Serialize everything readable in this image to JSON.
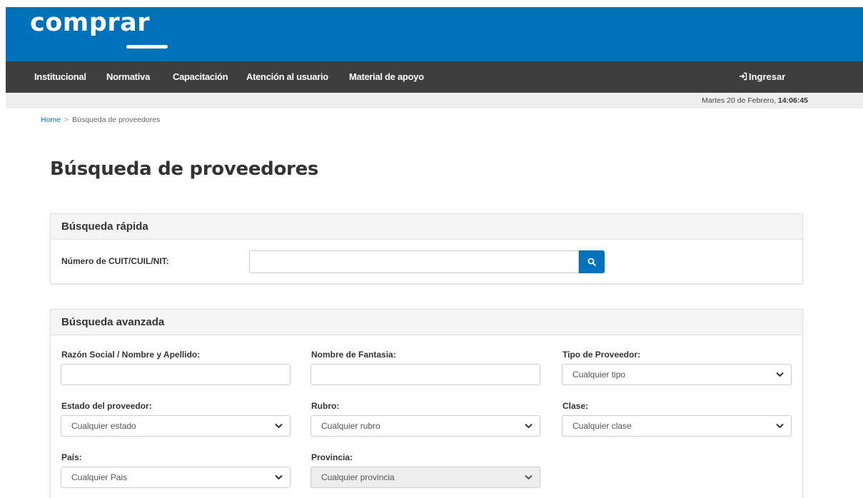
{
  "header": {
    "logo": "comprar"
  },
  "nav": {
    "items": [
      {
        "label": "Institucional"
      },
      {
        "label": "Normativa"
      },
      {
        "label": "Capacitación"
      },
      {
        "label": "Atención al usuario"
      },
      {
        "label": "Material de apoyo"
      }
    ],
    "login_label": "Ingresar",
    "login_icon": "sign-in-icon"
  },
  "datebar": {
    "date_prefix": "Martes 20 de Febrero,",
    "time": "14:06:45"
  },
  "breadcrumb": {
    "home": "Home",
    "separator": ">",
    "current": "Búsqueda de proveedores"
  },
  "page": {
    "title": "Búsqueda de proveedores"
  },
  "quick_search": {
    "title": "Búsqueda rápida",
    "cuit_label": "Número de CUIT/CUIL/NIT:",
    "cuit_value": "",
    "search_icon": "search-icon"
  },
  "advanced_search": {
    "title": "Búsqueda avanzada",
    "razon_social_label": "Razón Social / Nombre y Apellido:",
    "razon_social_value": "",
    "fantasia_label": "Nombre de Fantasia:",
    "fantasia_value": "",
    "tipo_label": "Tipo de Proveedor:",
    "tipo_selected": "Cualquier tipo",
    "estado_label": "Estado del proveedor:",
    "estado_selected": "Cualquier estado",
    "rubro_label": "Rubro:",
    "rubro_selected": "Cualquier rubro",
    "clase_label": "Clase:",
    "clase_selected": "Cualquier clase",
    "pais_label": "País:",
    "pais_selected": "Cualquier Pais",
    "provincia_label": "Provincia:",
    "provincia_selected": "Cualquier provincia"
  },
  "colors": {
    "brand_blue": "#0072bb",
    "nav_dark": "#3e3e3e"
  }
}
